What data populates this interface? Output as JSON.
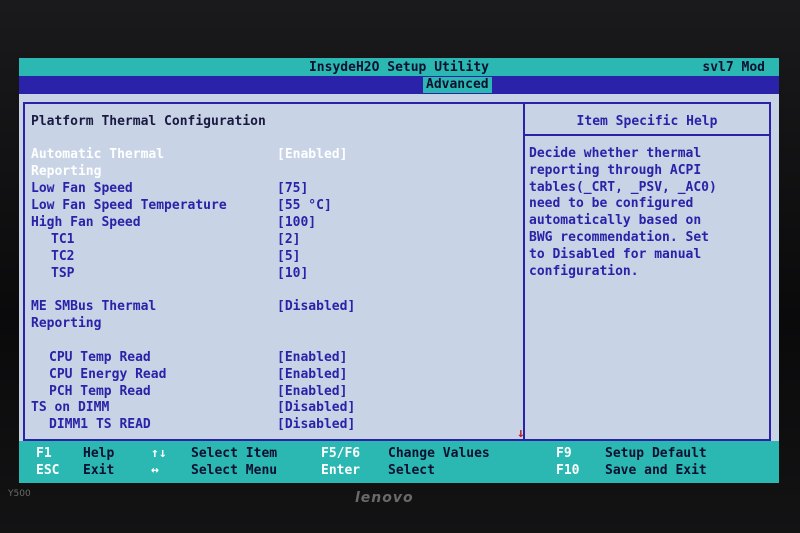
{
  "app": {
    "title": "InsydeH2O Setup Utility",
    "model": "svl7 Mod"
  },
  "tabs": [
    {
      "label": "Advanced",
      "active": true
    }
  ],
  "section_title": "Platform Thermal Configuration",
  "settings": [
    {
      "label": "Automatic Thermal",
      "value": "[Enabled]",
      "selected": true
    },
    {
      "label": "Reporting",
      "value": "",
      "selected": true
    },
    {
      "label": "Low Fan Speed",
      "value": "[75]"
    },
    {
      "label": "Low Fan Speed Temperature",
      "value": "[55 °C]"
    },
    {
      "label": "High Fan Speed",
      "value": "[100]"
    },
    {
      "label": "TC1",
      "value": "[2]"
    },
    {
      "label": "TC2",
      "value": "[5]"
    },
    {
      "label": "TSP",
      "value": "[10]"
    },
    {
      "label": "ME SMBus Thermal",
      "value": "[Disabled]"
    },
    {
      "label": "Reporting",
      "value": ""
    },
    {
      "label": "CPU Temp Read",
      "value": "[Enabled]"
    },
    {
      "label": "CPU Energy Read",
      "value": "[Enabled]"
    },
    {
      "label": "PCH Temp Read",
      "value": "[Enabled]"
    },
    {
      "label": "TS on DIMM",
      "value": "[Disabled]"
    },
    {
      "label": "DIMM1 TS READ",
      "value": "[Disabled]"
    }
  ],
  "scroll_indicator": "↓",
  "help": {
    "title": "Item Specific Help",
    "text": "Decide whether thermal\nreporting through ACPI\ntables(_CRT, _PSV, _AC0)\nneed to be configured\nautomatically based on\nBWG recommendation. Set\nto Disabled for manual\nconfiguration."
  },
  "footer": {
    "f1": "F1",
    "help": "Help",
    "esc": "ESC",
    "exit": "Exit",
    "updown": "↑↓",
    "select_item": "Select Item",
    "leftright": "↔",
    "select_menu": "Select Menu",
    "f5f6": "F5/F6",
    "change_values": "Change Values",
    "enter": "Enter",
    "select": "Select",
    "f9": "F9",
    "setup_default": "Setup Default",
    "f10": "F10",
    "save_exit": "Save and Exit"
  },
  "bezel": {
    "brand": "lenovo",
    "model_tag": "Y500"
  }
}
